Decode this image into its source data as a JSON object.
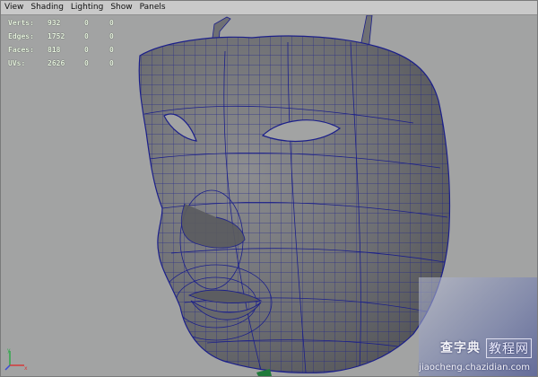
{
  "menu": {
    "items": [
      "View",
      "Shading",
      "Lighting",
      "Show",
      "Panels"
    ]
  },
  "hud": {
    "rows": [
      {
        "label": "Verts:",
        "value": "932",
        "z1": "0",
        "z2": "0"
      },
      {
        "label": "Edges:",
        "value": "1752",
        "z1": "0",
        "z2": "0"
      },
      {
        "label": "Faces:",
        "value": "818",
        "z1": "0",
        "z2": "0"
      },
      {
        "label": "UVs:",
        "value": "2626",
        "z1": "0",
        "z2": "0"
      }
    ]
  },
  "axis": {
    "x": "x",
    "y": "y"
  },
  "watermark": {
    "logo_a": "查字典",
    "logo_b": "教程网",
    "url": "jiaocheng.chazidian.com"
  },
  "colors": {
    "viewport": "#a2a3a3",
    "mesh_fill": "#6f7074",
    "wire": "#1b1f8a",
    "hud_text": "#e8f2e0"
  }
}
